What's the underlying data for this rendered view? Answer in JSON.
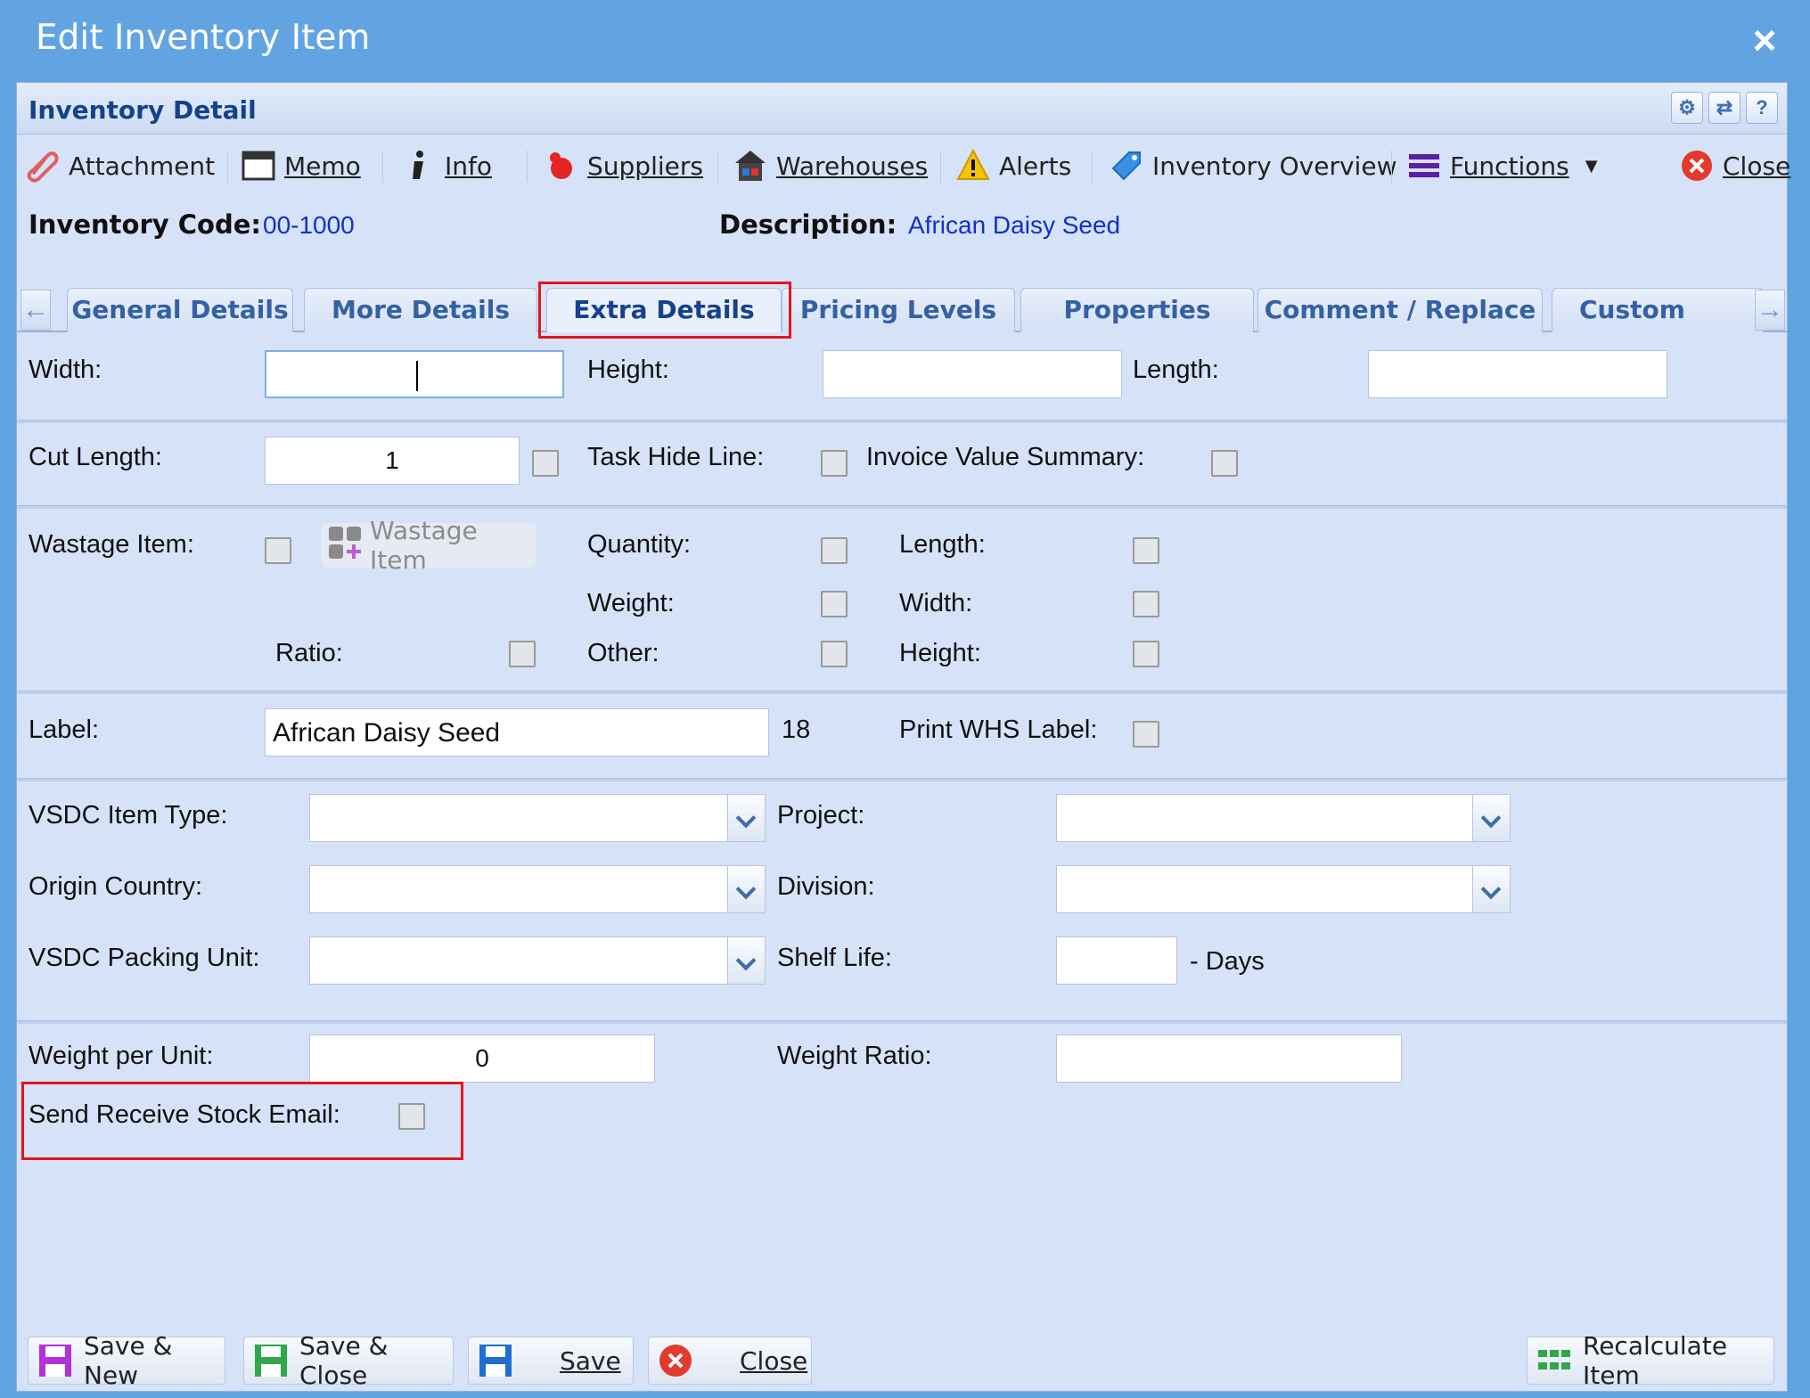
{
  "window": {
    "title": "Edit Inventory Item",
    "close_label": "×"
  },
  "panel": {
    "title": "Inventory Detail"
  },
  "toolbar": {
    "attachment": "Attachment",
    "memo": "Memo",
    "info": "Info",
    "suppliers": "Suppliers",
    "warehouses": "Warehouses",
    "alerts": "Alerts",
    "inventory_overview": "Inventory Overview",
    "functions": "Functions",
    "close": "Close"
  },
  "header": {
    "inventory_code_label": "Inventory Code:",
    "inventory_code": "00-1000",
    "description_label": "Description:",
    "description": "African Daisy Seed"
  },
  "tabs": [
    {
      "label": "General Details"
    },
    {
      "label": "More Details"
    },
    {
      "label": "Extra Details"
    },
    {
      "label": "Pricing Levels"
    },
    {
      "label": "Properties"
    },
    {
      "label": "Comment / Replace"
    },
    {
      "label": "Custom Fields"
    }
  ],
  "form": {
    "width_label": "Width:",
    "width_value": "",
    "height_label": "Height:",
    "height_value": "",
    "length_label": "Length:",
    "length_value": "",
    "cut_length_label": "Cut Length:",
    "cut_length_value": "1",
    "task_hide_line_label": "Task Hide Line:",
    "invoice_value_summary_label": "Invoice Value Summary:",
    "wastage_item_label": "Wastage Item:",
    "wastage_item_button": "Wastage Item",
    "quantity_label": "Quantity:",
    "w_length_label": "Length:",
    "weight_label": "Weight:",
    "w_width_label": "Width:",
    "ratio_label": "Ratio:",
    "other_label": "Other:",
    "w_height_label": "Height:",
    "label_label": "Label:",
    "label_value": "African Daisy Seed",
    "label_count": "18",
    "print_whs_label": "Print WHS Label:",
    "vsdc_item_type_label": "VSDC Item Type:",
    "project_label": "Project:",
    "origin_country_label": "Origin Country:",
    "division_label": "Division:",
    "vsdc_packing_unit_label": "VSDC Packing Unit:",
    "shelf_life_label": "Shelf Life:",
    "shelf_life_value": "",
    "days_label": "- Days",
    "weight_per_unit_label": "Weight per Unit:",
    "weight_per_unit_value": "0",
    "weight_ratio_label": "Weight Ratio:",
    "weight_ratio_value": "",
    "send_receive_stock_email_label": "Send Receive Stock Email:"
  },
  "bottom": {
    "save_new": "Save & New",
    "save_close": "Save & Close",
    "save": "Save",
    "close": "Close",
    "recalculate": "Recalculate Item"
  },
  "colors": {
    "title_bar": "#62a4e1",
    "panel_bg": "#d6e2f7",
    "highlight": "#e0161e",
    "link_value": "#1030d0"
  }
}
